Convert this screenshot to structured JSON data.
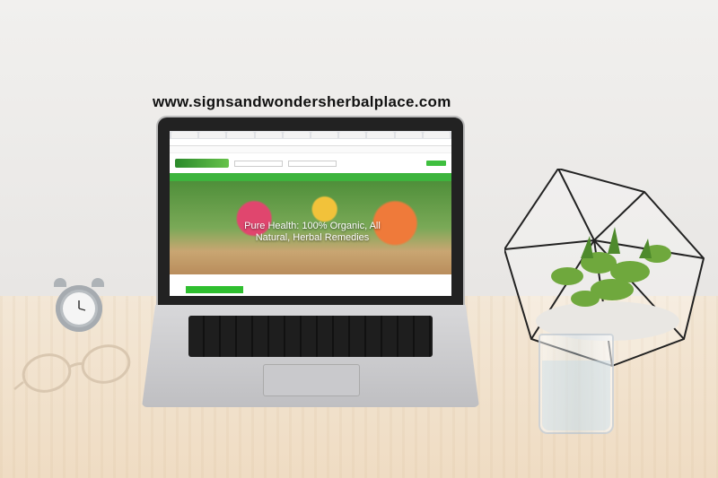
{
  "caption": {
    "url": "www.signsandwondersherbalplace.com"
  },
  "screen": {
    "hero_headline": "Pure Health: 100% Organic, All Natural, Herbal Remedies",
    "brand_green": "#3db43d"
  },
  "objects": {
    "laptop": "laptop-icon",
    "alarm_clock": "alarm-clock-icon",
    "eyeglasses": "eyeglasses-icon",
    "terrarium": "geometric-terrarium-icon",
    "water_glass": "glass-of-water-icon"
  }
}
